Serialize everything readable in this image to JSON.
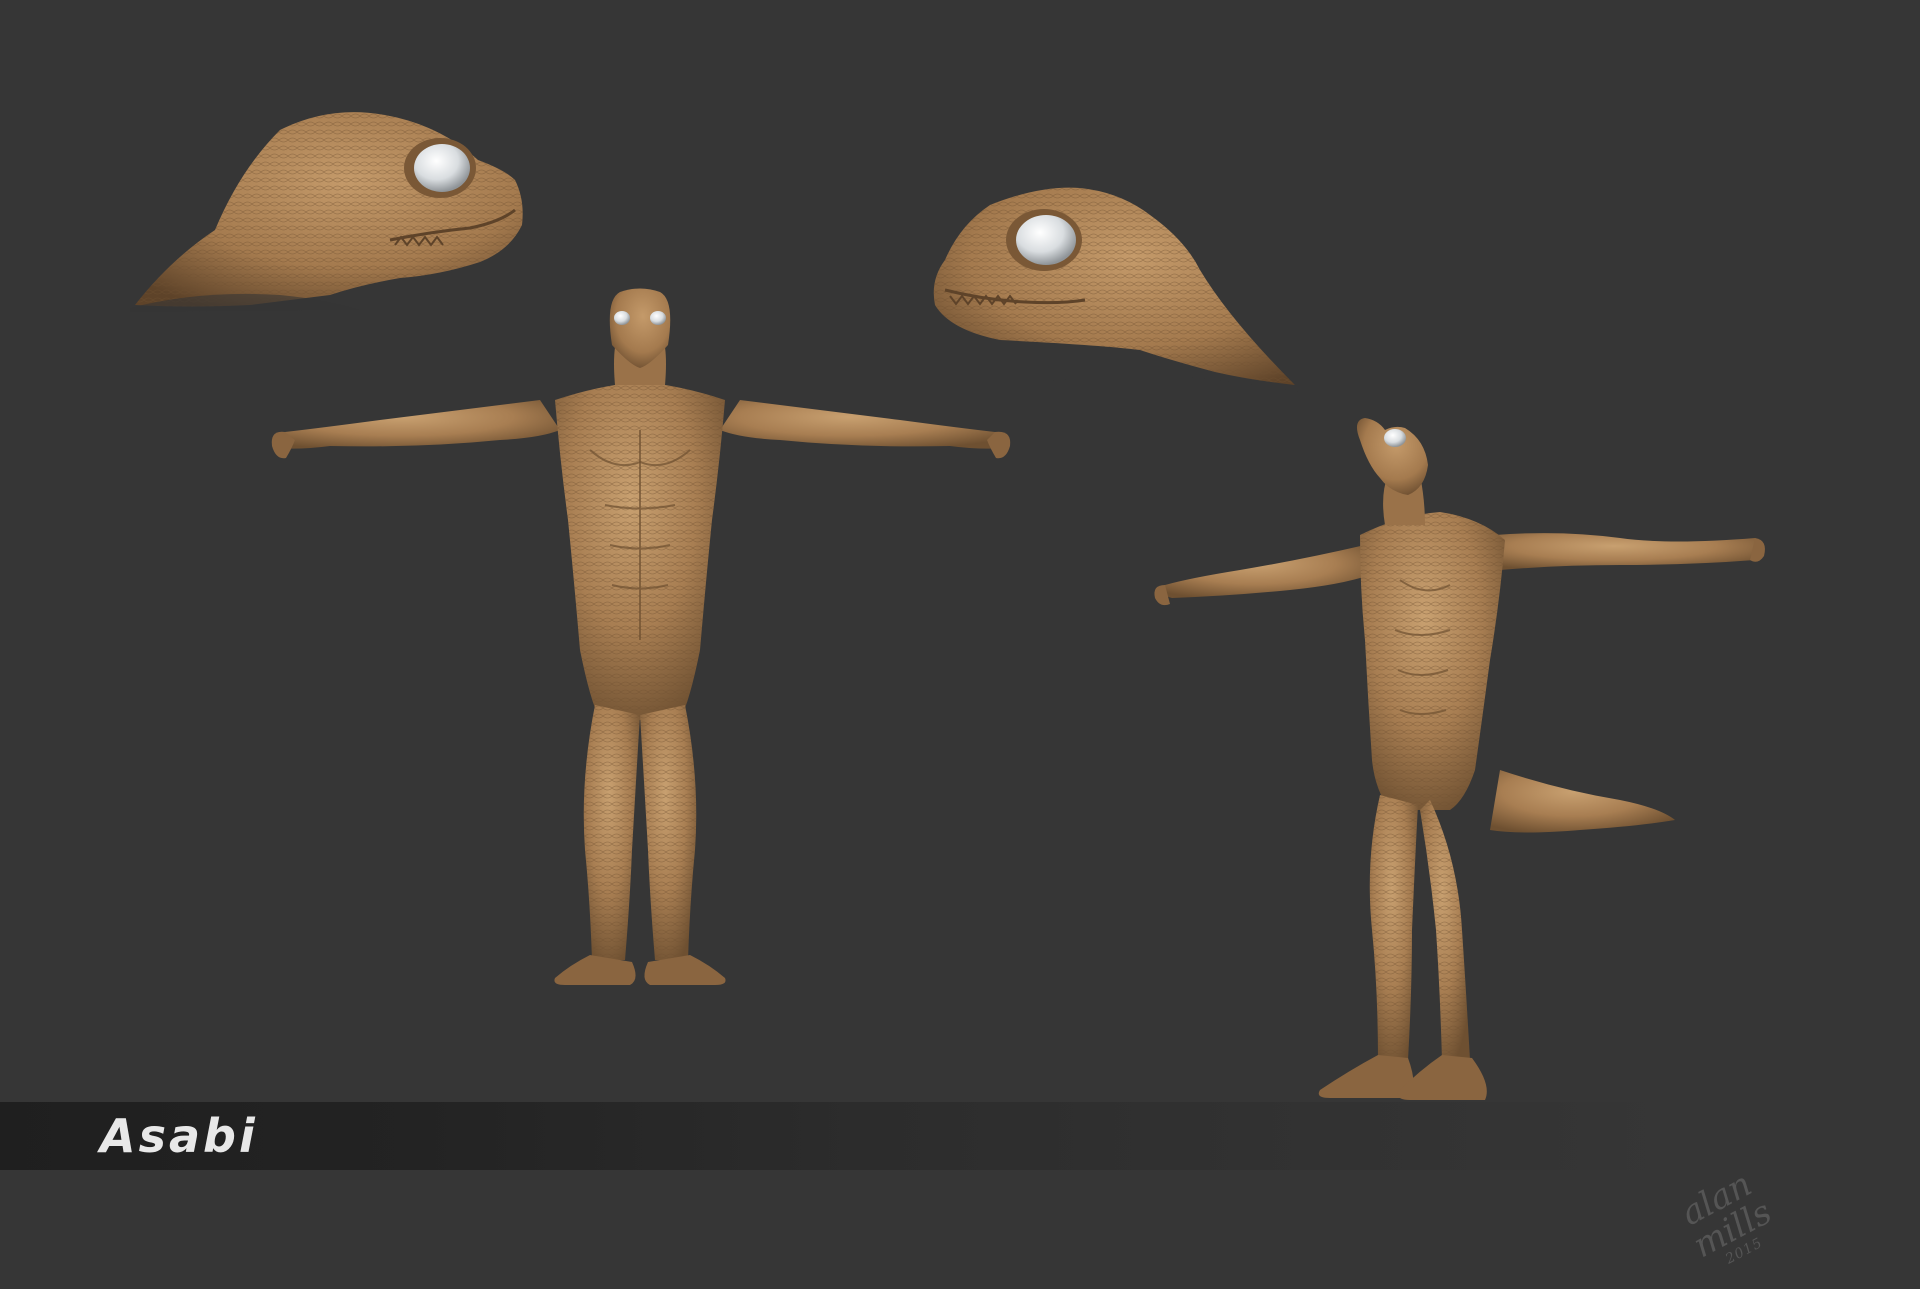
{
  "title": "Asabi",
  "signature": {
    "name": "alan mills",
    "year": "2015"
  },
  "colors": {
    "background": "#363636",
    "clay": "#a87e52",
    "clay_light": "#c49a6a",
    "clay_shadow": "#6e5031",
    "eye": "#d9dde0",
    "title_text": "#e8e8e8"
  },
  "views": [
    "head-three-quarter-left",
    "head-three-quarter-right",
    "front-t-pose",
    "three-quarter-t-pose"
  ]
}
